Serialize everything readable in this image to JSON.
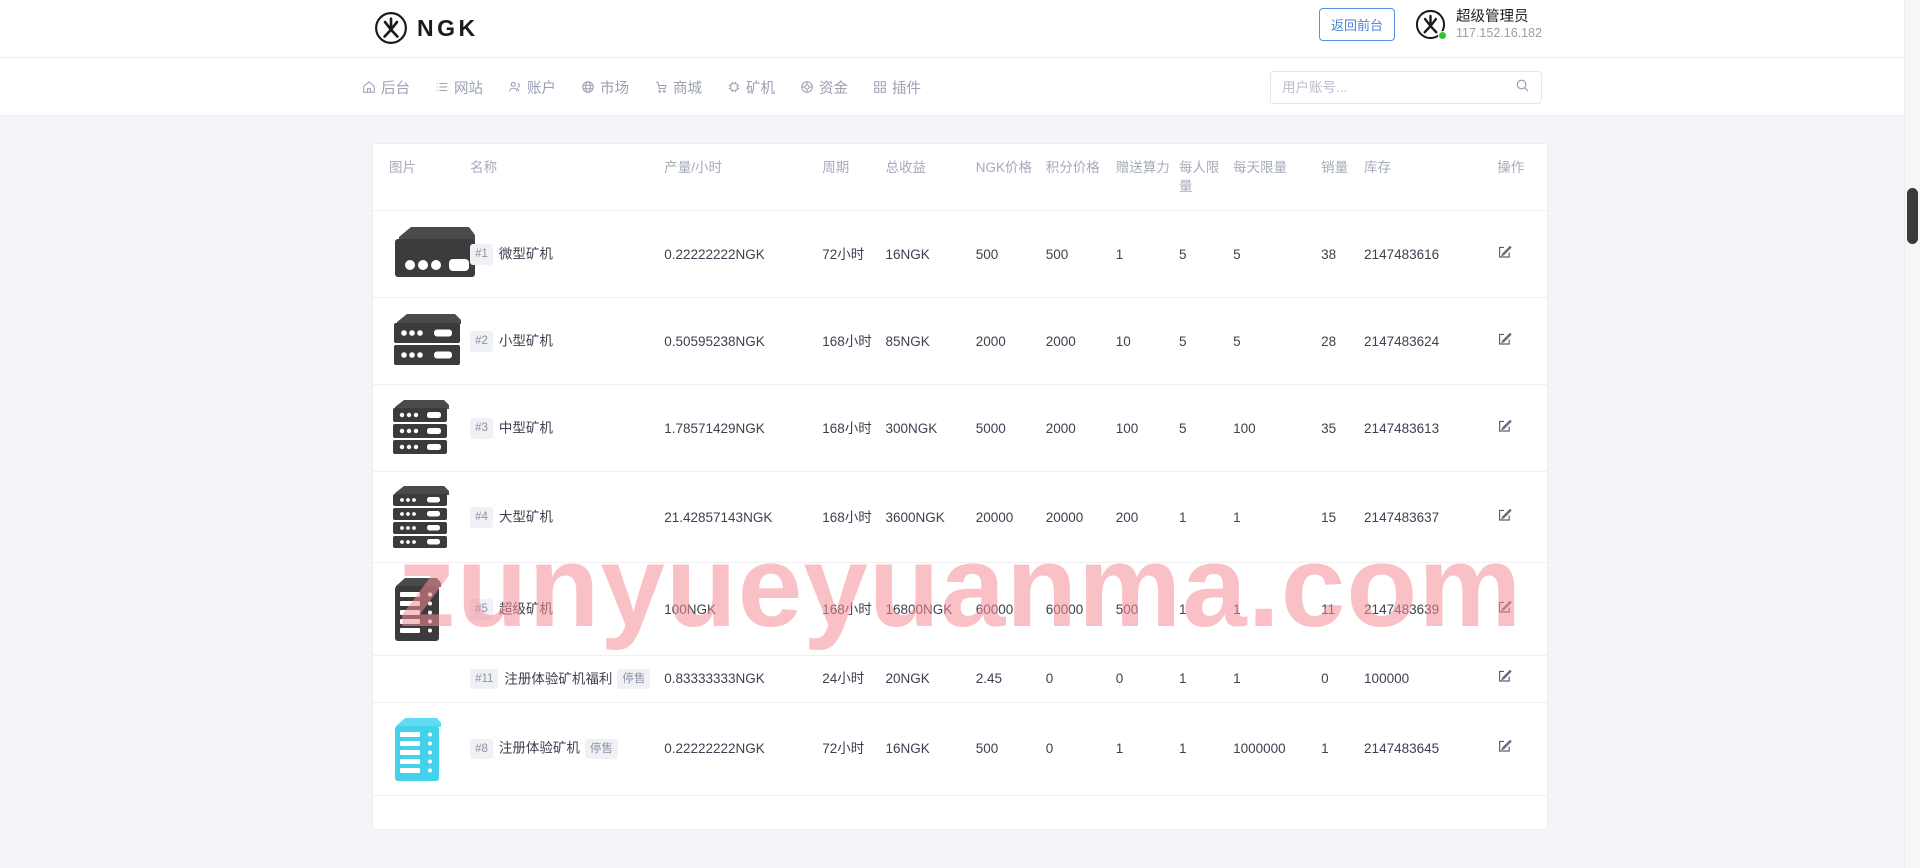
{
  "topbar": {
    "brand_name": "NGK",
    "brand_icon": "ngk-logo-icon",
    "front_button": "返回前台",
    "user_name": "超级管理员",
    "user_ip": "117.152.16.182"
  },
  "nav": {
    "items": [
      {
        "label": "后台",
        "icon": "home-icon"
      },
      {
        "label": "网站",
        "icon": "list-icon"
      },
      {
        "label": "账户",
        "icon": "users-icon"
      },
      {
        "label": "市场",
        "icon": "globe-icon"
      },
      {
        "label": "商城",
        "icon": "cart-icon"
      },
      {
        "label": "矿机",
        "icon": "chip-icon"
      },
      {
        "label": "资金",
        "icon": "coin-icon"
      },
      {
        "label": "插件",
        "icon": "grid-icon"
      }
    ],
    "search_placeholder": "用户账号...",
    "search_value": "",
    "search_icon": "search-icon"
  },
  "table": {
    "headers": [
      "图片",
      "名称",
      "产量/小时",
      "周期",
      "总收益",
      "NGK价格",
      "积分价格",
      "赠送算力",
      "每人限量",
      "每天限量",
      "销量",
      "库存",
      "操作"
    ],
    "rows": [
      {
        "id": "#1",
        "name": "微型矿机",
        "stopped": "",
        "image": "miner-dark-1u",
        "output": "0.22222222NGK",
        "cycle": "72小时",
        "revenue": "16NGK",
        "ngk_price": "500",
        "point_price": "500",
        "gift_power": "1",
        "per_limit": "5",
        "day_limit": "5",
        "sold": "38",
        "stock": "2147483616",
        "action_icon": "edit-icon"
      },
      {
        "id": "#2",
        "name": "小型矿机",
        "stopped": "",
        "image": "miner-dark-2u",
        "output": "0.50595238NGK",
        "cycle": "168小时",
        "revenue": "85NGK",
        "ngk_price": "2000",
        "point_price": "2000",
        "gift_power": "10",
        "per_limit": "5",
        "day_limit": "5",
        "sold": "28",
        "stock": "2147483624",
        "action_icon": "edit-icon"
      },
      {
        "id": "#3",
        "name": "中型矿机",
        "stopped": "",
        "image": "miner-dark-3u",
        "output": "1.78571429NGK",
        "cycle": "168小时",
        "revenue": "300NGK",
        "ngk_price": "5000",
        "point_price": "2000",
        "gift_power": "100",
        "per_limit": "5",
        "day_limit": "100",
        "sold": "35",
        "stock": "2147483613",
        "action_icon": "edit-icon"
      },
      {
        "id": "#4",
        "name": "大型矿机",
        "stopped": "",
        "image": "miner-dark-4u",
        "output": "21.42857143NGK",
        "cycle": "168小时",
        "revenue": "3600NGK",
        "ngk_price": "20000",
        "point_price": "20000",
        "gift_power": "200",
        "per_limit": "1",
        "day_limit": "1",
        "sold": "15",
        "stock": "2147483637",
        "action_icon": "edit-icon"
      },
      {
        "id": "#5",
        "name": "超级矿机",
        "stopped": "",
        "image": "miner-dark-rack",
        "output": "100NGK",
        "cycle": "168小时",
        "revenue": "16800NGK",
        "ngk_price": "60000",
        "point_price": "60000",
        "gift_power": "500",
        "per_limit": "1",
        "day_limit": "1",
        "sold": "11",
        "stock": "2147483639",
        "action_icon": "edit-icon"
      },
      {
        "id": "#11",
        "name": "注册体验矿机福利",
        "stopped": "停售",
        "image": "",
        "output": "0.83333333NGK",
        "cycle": "24小时",
        "revenue": "20NGK",
        "ngk_price": "2.45",
        "point_price": "0",
        "gift_power": "0",
        "per_limit": "1",
        "day_limit": "1",
        "sold": "0",
        "stock": "100000",
        "action_icon": "edit-icon"
      },
      {
        "id": "#8",
        "name": "注册体验矿机",
        "stopped": "停售",
        "image": "miner-cyan-rack",
        "output": "0.22222222NGK",
        "cycle": "72小时",
        "revenue": "16NGK",
        "ngk_price": "500",
        "point_price": "0",
        "gift_power": "1",
        "per_limit": "1",
        "day_limit": "1000000",
        "sold": "1",
        "stock": "2147483645",
        "action_icon": "edit-icon"
      }
    ]
  },
  "watermark": {
    "text": "zunyueyuanma.com"
  },
  "colors": {
    "accent_blue": "#4a82d8",
    "nav_text": "#9ba0b3",
    "table_header": "#a6abbb",
    "cyan_miner": "#44d2ea",
    "dark_miner": "#3b3b3b",
    "online_dot": "#2fc52f",
    "watermark": "#f48c96"
  }
}
